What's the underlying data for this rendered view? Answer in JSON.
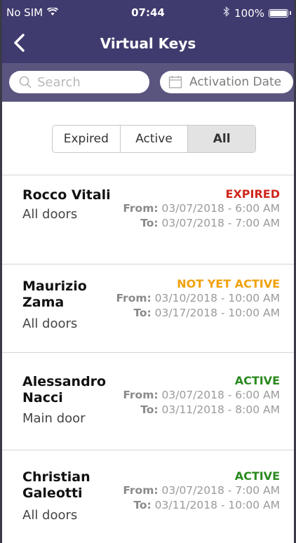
{
  "status_bar": {
    "carrier": "No SIM",
    "time": "07:44",
    "battery_percent": "100%",
    "battery_level": 1.0
  },
  "nav": {
    "title": "Virtual Keys",
    "back_icon": "chevron-left-icon"
  },
  "search": {
    "placeholder": "Search",
    "date_filter_label": "Activation Date"
  },
  "filter_tabs": [
    {
      "label": "Expired",
      "selected": false
    },
    {
      "label": "Active",
      "selected": false
    },
    {
      "label": "All",
      "selected": true
    }
  ],
  "keys": [
    {
      "name": "Rocco Vitali",
      "doors": "All doors",
      "status": "EXPIRED",
      "status_color": "#d0271d",
      "from_label": "From:",
      "from": "03/07/2018 - 6:00 AM",
      "to_label": "To:",
      "to": "03/07/2018 - 7:00 AM"
    },
    {
      "name": "Maurizio Zama",
      "doors": "All doors",
      "status": "NOT YET ACTIVE",
      "status_color": "#f0a10a",
      "from_label": "From:",
      "from": "03/10/2018 - 10:00 AM",
      "to_label": "To:",
      "to": "03/17/2018 - 10:00 AM"
    },
    {
      "name": "Alessandro Nacci",
      "doors": "Main door",
      "status": "ACTIVE",
      "status_color": "#2a8a1f",
      "from_label": "From:",
      "from": "03/07/2018 - 6:00 AM",
      "to_label": "To:",
      "to": "03/11/2018 - 8:00 AM"
    },
    {
      "name": "Christian Galeotti",
      "doors": "All doors",
      "status": "ACTIVE",
      "status_color": "#2a8a1f",
      "from_label": "From:",
      "from": "03/07/2018 - 7:00 AM",
      "to_label": "To:",
      "to": "03/11/2018 - 10:00 AM"
    }
  ],
  "colors": {
    "header": "#3f3b6e",
    "search_row": "#5a557f"
  }
}
